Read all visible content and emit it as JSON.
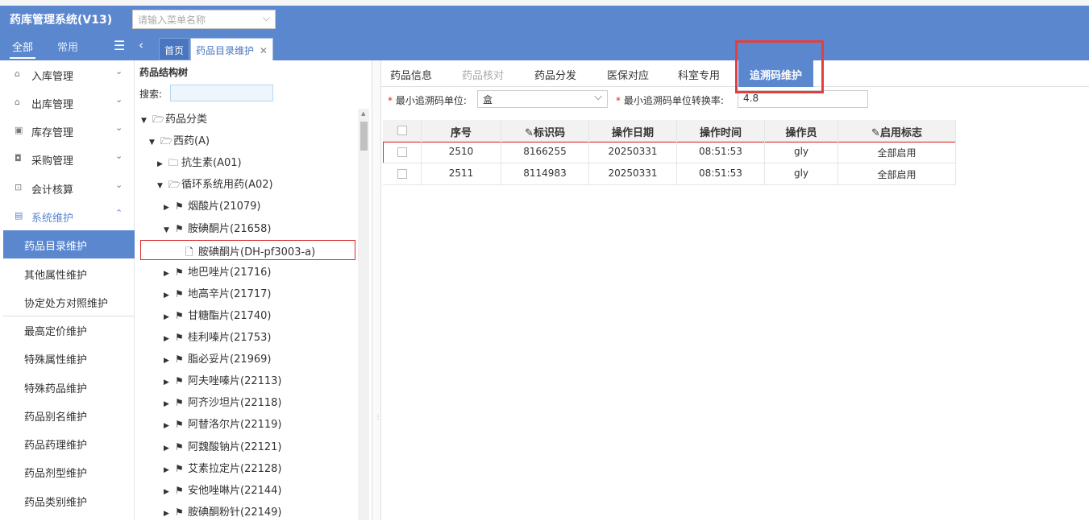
{
  "app": {
    "title": "药库管理系统(V13)",
    "menu_search_placeholder": "请输入菜单名称"
  },
  "nav": {
    "tab_all": "全部",
    "tab_common": "常用",
    "page_tabs": [
      "首页",
      "药品目录维护"
    ]
  },
  "sidebar": {
    "groups": [
      {
        "label": "入库管理",
        "icon": "inbox-icon",
        "chevron": "⌄"
      },
      {
        "label": "出库管理",
        "icon": "outbox-icon",
        "chevron": "⌄"
      },
      {
        "label": "库存管理",
        "icon": "inventory-icon",
        "chevron": "⌄"
      },
      {
        "label": "采购管理",
        "icon": "purchase-icon",
        "chevron": "⌄"
      },
      {
        "label": "会计核算",
        "icon": "accounting-icon",
        "chevron": "⌄"
      },
      {
        "label": "系统维护",
        "icon": "system-icon",
        "chevron": "⌃"
      }
    ],
    "items": [
      "药品目录维护",
      "其他属性维护",
      "协定处方对照维护",
      "最高定价维护",
      "特殊属性维护",
      "特殊药品维护",
      "药品别名维护",
      "药品药理维护",
      "药品剂型维护",
      "药品类别维护"
    ]
  },
  "tree": {
    "title": "药品结构树",
    "search_label": "搜索:",
    "nodes": [
      {
        "label": "药品分类",
        "level": 0,
        "toggle": "▼",
        "icon": "🗁"
      },
      {
        "label": "西药(A)",
        "level": 1,
        "toggle": "▼",
        "icon": "🗁"
      },
      {
        "label": "抗生素(A01)",
        "level": 2,
        "toggle": "▶",
        "icon": "🗀"
      },
      {
        "label": "循环系统用药(A02)",
        "level": 2,
        "toggle": "▼",
        "icon": "🗁"
      },
      {
        "label": "烟酸片(21079)",
        "level": 3,
        "toggle": "▶",
        "icon": "⚑"
      },
      {
        "label": "胺碘酮片(21658)",
        "level": 3,
        "toggle": "▼",
        "icon": "⚑"
      },
      {
        "label": "胺碘酮片(DH-pf3003-a)",
        "level": 4,
        "toggle": "",
        "icon": "🗋",
        "selected": true
      },
      {
        "label": "地巴唑片(21716)",
        "level": 3,
        "toggle": "▶",
        "icon": "⚑"
      },
      {
        "label": "地高辛片(21717)",
        "level": 3,
        "toggle": "▶",
        "icon": "⚑"
      },
      {
        "label": "甘糖酯片(21740)",
        "level": 3,
        "toggle": "▶",
        "icon": "⚑"
      },
      {
        "label": "桂利嗪片(21753)",
        "level": 3,
        "toggle": "▶",
        "icon": "⚑"
      },
      {
        "label": "脂必妥片(21969)",
        "level": 3,
        "toggle": "▶",
        "icon": "⚑"
      },
      {
        "label": "阿夫唑嗪片(22113)",
        "level": 3,
        "toggle": "▶",
        "icon": "⚑"
      },
      {
        "label": "阿齐沙坦片(22118)",
        "level": 3,
        "toggle": "▶",
        "icon": "⚑"
      },
      {
        "label": "阿替洛尔片(22119)",
        "level": 3,
        "toggle": "▶",
        "icon": "⚑"
      },
      {
        "label": "阿魏酸钠片(22121)",
        "level": 3,
        "toggle": "▶",
        "icon": "⚑"
      },
      {
        "label": "艾素拉定片(22128)",
        "level": 3,
        "toggle": "▶",
        "icon": "⚑"
      },
      {
        "label": "安他唑啉片(22144)",
        "level": 3,
        "toggle": "▶",
        "icon": "⚑"
      },
      {
        "label": "胺碘酮粉针(22149)",
        "level": 3,
        "toggle": "▶",
        "icon": "⚑"
      }
    ]
  },
  "tabs": [
    "药品信息",
    "药品核对",
    "药品分发",
    "医保对应",
    "科室专用",
    "追溯码维护"
  ],
  "form": {
    "unit_label": "最小追溯码单位:",
    "unit_value": "盒",
    "ratio_label": "最小追溯码单位转换率:",
    "ratio_value": "4.8"
  },
  "grid": {
    "headers": [
      "序号",
      "标识码",
      "操作日期",
      "操作时间",
      "操作员",
      "启用标志"
    ],
    "rows": [
      [
        "2510",
        "8166255",
        "20250331",
        "08:51:53",
        "gly",
        "全部启用"
      ],
      [
        "2511",
        "8114983",
        "20250331",
        "08:51:53",
        "gly",
        "全部启用"
      ]
    ]
  }
}
